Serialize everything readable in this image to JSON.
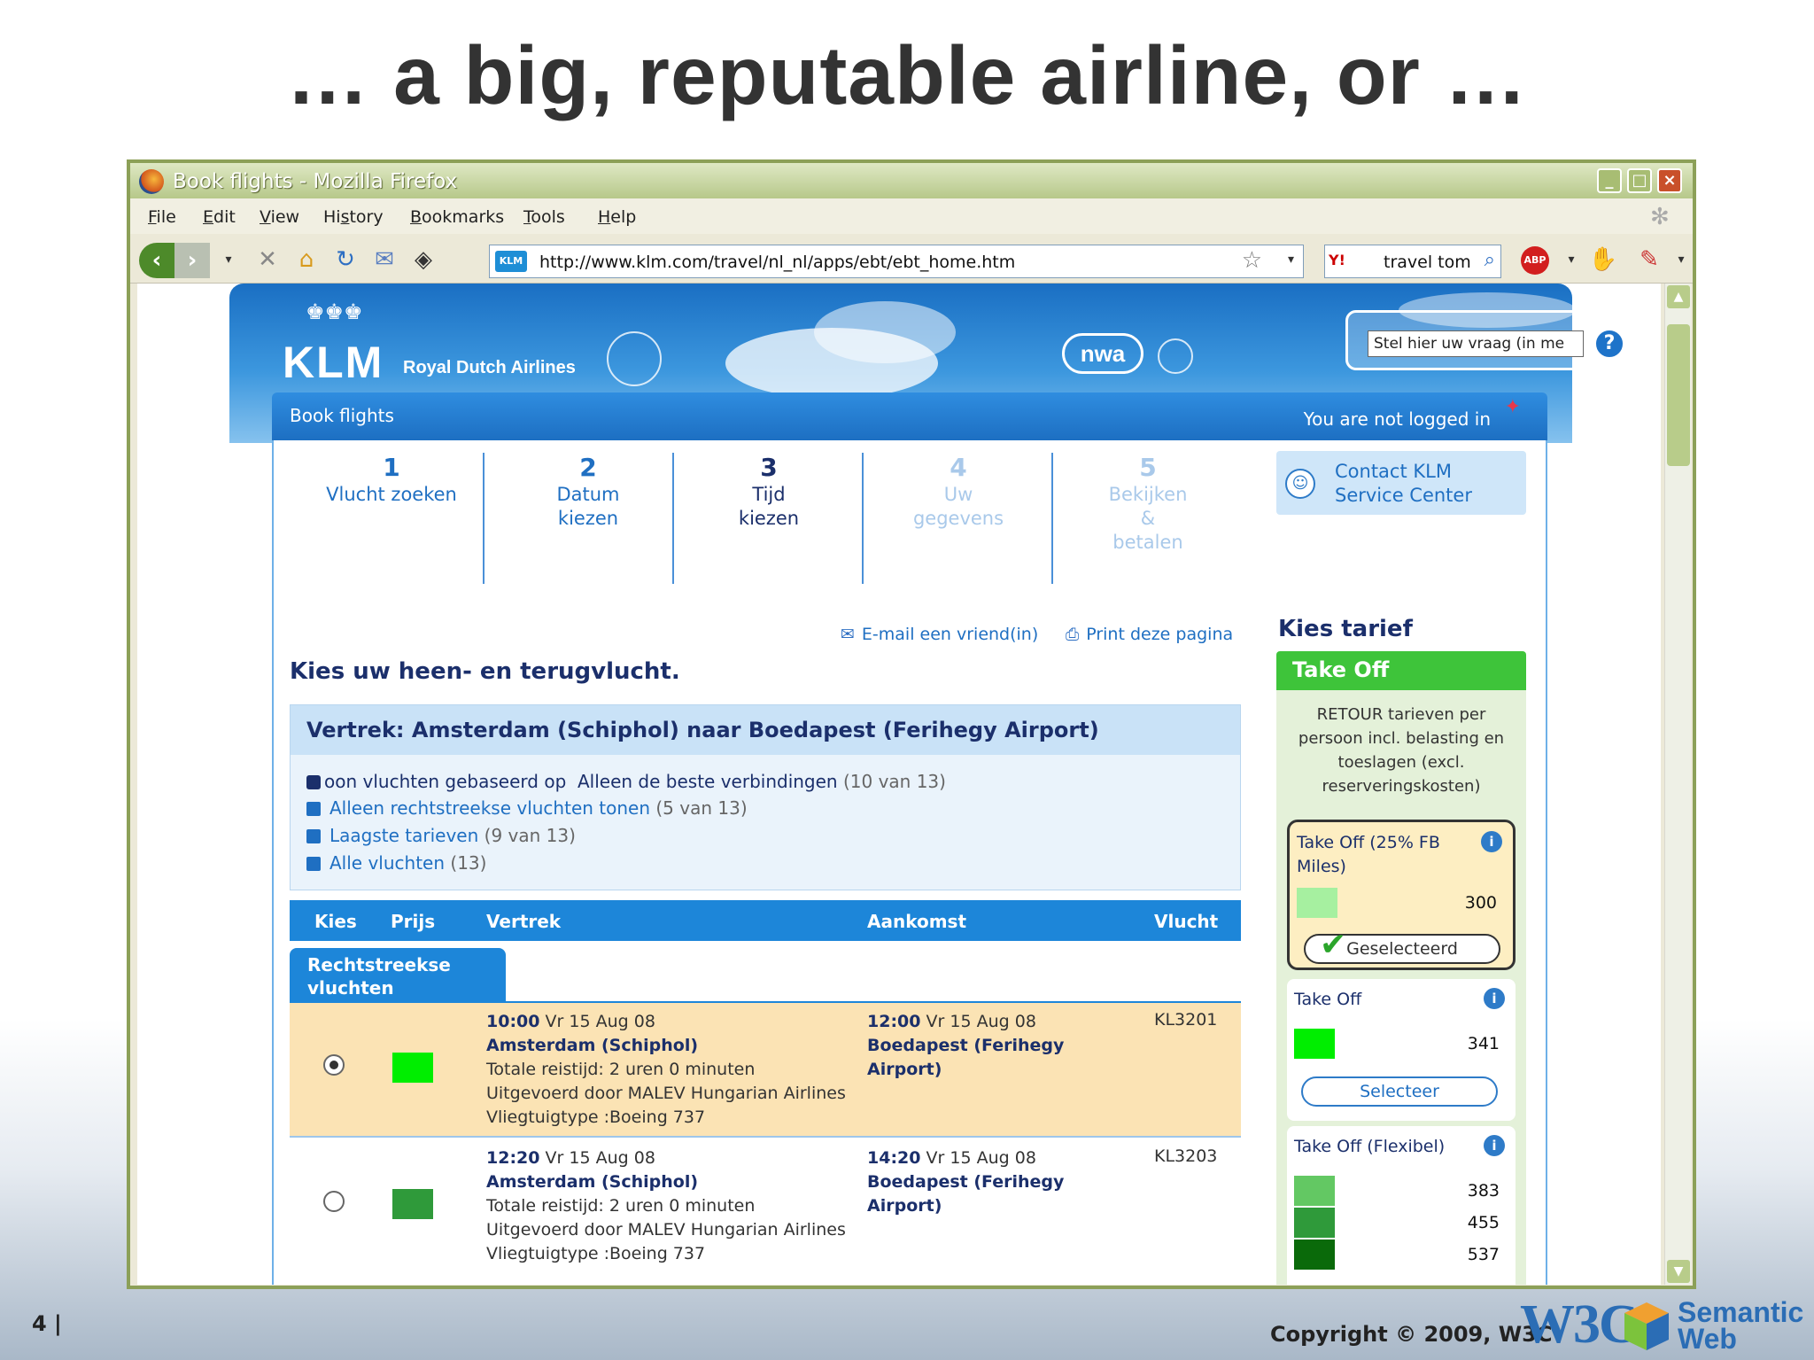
{
  "slide": {
    "title": "… a big, reputable airline, or …",
    "page_number": "4 |",
    "copyright": "Copyright © 2009, W3C",
    "logo_text": "W3C",
    "logo_sub": "Semantic",
    "logo_sub2": "Web"
  },
  "browser": {
    "window_title": "Book flights - Mozilla Firefox",
    "window_buttons": [
      "_",
      "□",
      "×"
    ],
    "menu": [
      "File",
      "Edit",
      "View",
      "History",
      "Bookmarks",
      "Tools",
      "Help"
    ],
    "menu_accel": [
      "F",
      "E",
      "V",
      "s",
      "B",
      "T",
      "H"
    ],
    "url": "http://www.klm.com/travel/nl_nl/apps/ebt/ebt_home.htm",
    "search_text": "travel tom",
    "search_engine": "Y!",
    "abp_label": "ABP"
  },
  "klm": {
    "logo": "KLM",
    "crown": "♚♚♚",
    "tagline": "Royal Dutch Airlines",
    "nwa": "nwa",
    "question_placeholder": "Stel hier uw vraag (in me",
    "help_label": "?",
    "book_title": "Book flights",
    "login_status": "You are not logged in",
    "steps": [
      {
        "num": "1",
        "label": "Vlucht zoeken"
      },
      {
        "num": "2",
        "label": "Datum kiezen"
      },
      {
        "num": "3",
        "label": "Tijd kiezen"
      },
      {
        "num": "4",
        "label": "Uw gegevens"
      },
      {
        "num": "5",
        "label": "Bekijken & betalen"
      }
    ],
    "contact": "Contact KLM Service Center",
    "email_link": "E-mail een vriend(in)",
    "print_link": "Print deze pagina",
    "page_heading": "Kies uw heen- en terugvlucht.",
    "route": "Vertrek: Amsterdam (Schiphol) naar Boedapest (Ferihegy Airport)",
    "filter_current": "oon vluchten gebaseerd op",
    "filter_selected": "Alleen de beste verbindingen",
    "filter_selected_count": "(10 van 13)",
    "filters": [
      {
        "label": "Alleen rechtstreekse vluchten tonen",
        "count": "(5 van 13)"
      },
      {
        "label": "Laagste tarieven",
        "count": "(9 van 13)"
      },
      {
        "label": "Alle vluchten",
        "count": "(13)"
      }
    ],
    "table_headers": [
      "Kies",
      "Prijs",
      "Vertrek",
      "Aankomst",
      "Vlucht"
    ],
    "tab_direct": "Rechtstreekse vluchten",
    "flights": [
      {
        "selected": true,
        "price_color": "#00ee00",
        "dep_time": "10:00",
        "dep_date": "Vr 15 Aug 08",
        "dep_place": "Amsterdam (Schiphol)",
        "duration": "Totale reistijd: 2 uren 0 minuten",
        "operator": "Uitgevoerd door MALEV Hungarian Airlines",
        "aircraft": "Vliegtuigtype :Boeing 737",
        "arr_time": "12:00",
        "arr_date": "Vr 15 Aug 08",
        "arr_place": "Boedapest (Ferihegy Airport)",
        "flight_no": "KL3201"
      },
      {
        "selected": false,
        "price_color": "#2f9a3a",
        "dep_time": "12:20",
        "dep_date": "Vr 15 Aug 08",
        "dep_place": "Amsterdam (Schiphol)",
        "duration": "Totale reistijd: 2 uren 0 minuten",
        "operator": "Uitgevoerd door MALEV Hungarian Airlines",
        "aircraft": "Vliegtuigtype :Boeing 737",
        "arr_time": "14:20",
        "arr_date": "Vr 15 Aug 08",
        "arr_place": "Boedapest (Ferihegy Airport)",
        "flight_no": "KL3203"
      }
    ],
    "tarief_title": "Kies tarief",
    "takeoff_title": "Take Off",
    "takeoff_desc": "RETOUR tarieven per persoon incl. belasting en toeslagen (excl. reserveringskosten)",
    "fares": [
      {
        "name": "Take Off (25% FB Miles)",
        "prices": [
          "300"
        ],
        "colors": [
          "#a6f0a0"
        ],
        "button": "Geselecteerd"
      },
      {
        "name": "Take Off",
        "prices": [
          "341"
        ],
        "colors": [
          "#00ee00"
        ],
        "button": "Selecteer"
      },
      {
        "name": "Take Off (Flexibel)",
        "prices": [
          "383",
          "455",
          "537"
        ],
        "colors": [
          "#63c863",
          "#2f9a3a",
          "#0a6a0a"
        ]
      }
    ]
  }
}
